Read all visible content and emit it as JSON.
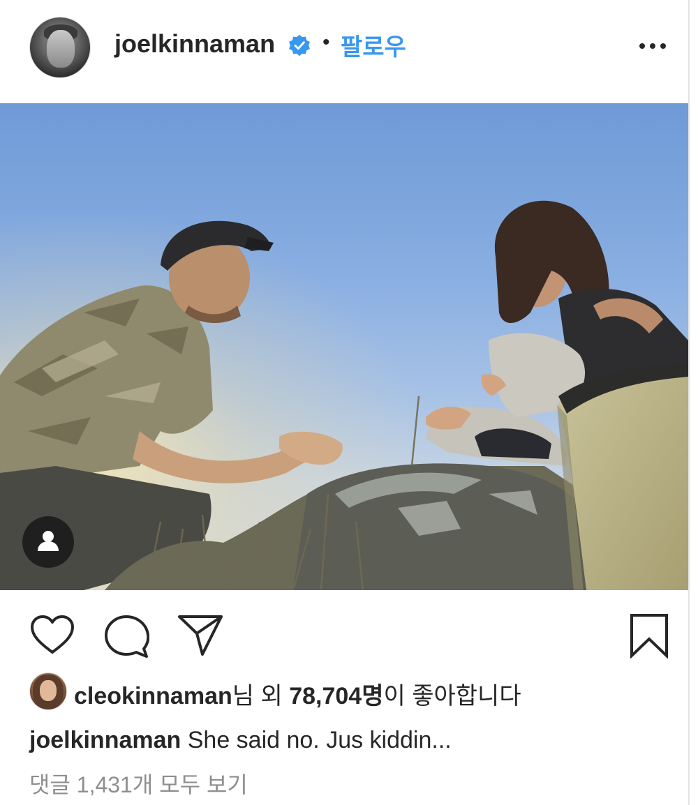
{
  "header": {
    "username": "joelkinnaman",
    "separator": "•",
    "follow_label": "팔로우",
    "more_icon": "more-horizontal-icon",
    "verified_icon": "verified-badge-icon",
    "verified_color": "#3897f0"
  },
  "photo": {
    "user_tag_icon": "user-tag-icon"
  },
  "actions": {
    "like_icon": "heart-icon",
    "comment_icon": "comment-icon",
    "share_icon": "paper-plane-icon",
    "save_icon": "bookmark-icon"
  },
  "likes": {
    "liker_username": "cleokinnaman",
    "liker_suffix": "님 외 ",
    "count": "78,704",
    "count_suffix": "명",
    "tail": "이 좋아합니다"
  },
  "caption": {
    "author": "joelkinnaman",
    "text": " She said no. Jus kiddin..."
  },
  "comments": {
    "view_all_label": "댓글 1,431개 모두 보기"
  },
  "colors": {
    "link_blue": "#3897f0",
    "text": "#262626",
    "secondary_text": "#8e8e8e"
  }
}
